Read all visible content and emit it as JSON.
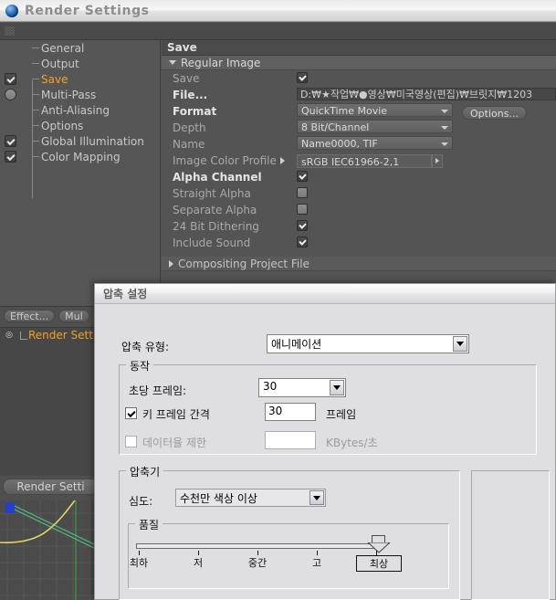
{
  "window": {
    "title": "Render Settings",
    "icon": "sphere-orb-icon"
  },
  "tree": {
    "items": [
      {
        "label": "General",
        "checkbox": "none",
        "selected": false
      },
      {
        "label": "Output",
        "checkbox": "none",
        "selected": false
      },
      {
        "label": "Save",
        "checkbox": "checked",
        "selected": true
      },
      {
        "label": "Multi-Pass",
        "checkbox": "round",
        "selected": false
      },
      {
        "label": "Anti-Aliasing",
        "checkbox": "none",
        "selected": false
      },
      {
        "label": "Options",
        "checkbox": "none",
        "selected": false
      },
      {
        "label": "Global Illumination",
        "checkbox": "checked",
        "selected": false
      },
      {
        "label": "Color Mapping",
        "checkbox": "checked",
        "selected": false
      }
    ]
  },
  "properties": {
    "header": "Save",
    "group_regular": "Regular Image",
    "group_compositing": "Compositing Project File",
    "rows": [
      {
        "label": "Save",
        "bold": false,
        "type": "checkbox",
        "value": "checked"
      },
      {
        "label": "File...",
        "bold": true,
        "type": "text",
        "value": "D:₩★작업₩●영상₩미국영상(편집)₩브릿지₩1203"
      },
      {
        "label": "Format",
        "bold": true,
        "type": "combo",
        "value": "QuickTime Movie"
      },
      {
        "label": "Depth",
        "bold": false,
        "type": "combo",
        "value": "8 Bit/Channel"
      },
      {
        "label": "Name",
        "bold": false,
        "type": "combo",
        "value": "Name0000, TIF"
      },
      {
        "label": "Image Color Profile",
        "bold": false,
        "type": "profile",
        "value": "sRGB IEC61966-2,1"
      },
      {
        "label": "Alpha Channel",
        "bold": true,
        "type": "checkbox",
        "value": "checked"
      },
      {
        "label": "Straight Alpha",
        "bold": false,
        "type": "checkbox",
        "value": "unchecked"
      },
      {
        "label": "Separate Alpha",
        "bold": false,
        "type": "checkbox",
        "value": "unchecked"
      },
      {
        "label": "24 Bit Dithering",
        "bold": false,
        "type": "checkbox",
        "value": "checked"
      },
      {
        "label": "Include Sound",
        "bold": false,
        "type": "checkbox",
        "value": "checked"
      }
    ],
    "options_button": "Options..."
  },
  "object_manager": {
    "buttons": [
      "Effect...",
      "Mul"
    ],
    "item": "Render Setti",
    "footer": "Render Setti"
  },
  "dialog": {
    "title": "압축 설정",
    "compression_type_label": "압축 유형:",
    "compression_type_value": "애니메이션",
    "motion_group": "동작",
    "fps_label": "초당 프레임:",
    "fps_value": "30",
    "keyframe_label": "키 프레임 간격",
    "keyframe_checked": true,
    "keyframe_value": "30",
    "keyframe_unit": "프레임",
    "datarate_label": "데이터율 제한",
    "datarate_checked": false,
    "datarate_value": "",
    "datarate_unit": "KBytes/초",
    "compressor_group": "압축기",
    "depth_label": "심도:",
    "depth_value": "수천만 색상 이상",
    "quality_group": "품질",
    "quality_ticks": [
      "최하",
      "저",
      "중간",
      "고",
      "최상"
    ],
    "quality_selected_index": 4
  }
}
